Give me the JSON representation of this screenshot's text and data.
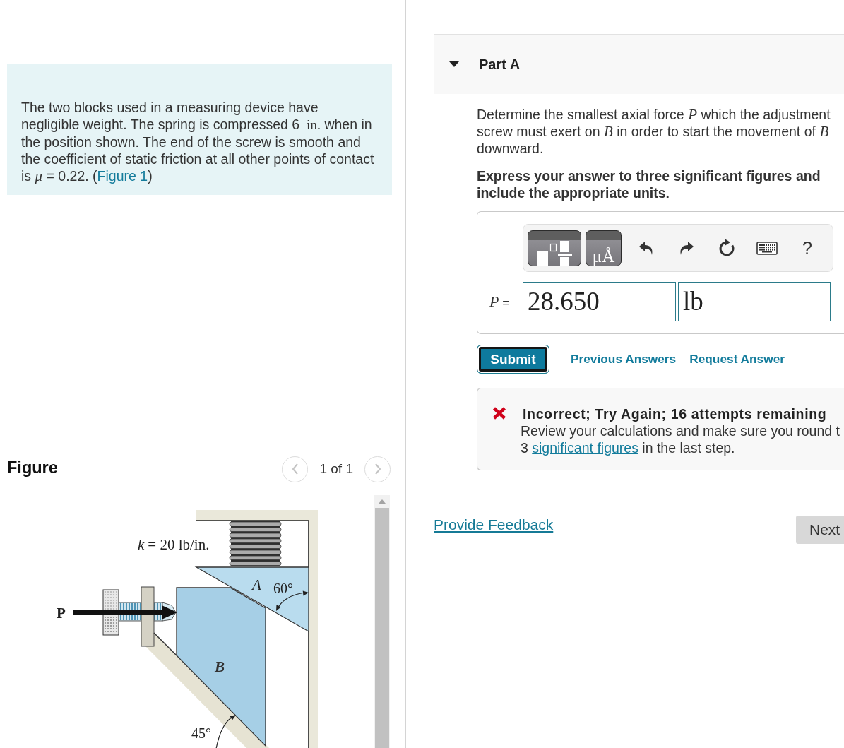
{
  "problem": {
    "segments": [
      {
        "kind": "text",
        "text": "The two blocks used in a measuring device have negligible weight. The spring is compressed 6"
      },
      {
        "kind": "unit",
        "text": "in."
      },
      {
        "kind": "text",
        "text": " when in the position shown. The end of the screw is smooth and the coefficient of static friction at all other points of contact is "
      },
      {
        "kind": "math",
        "text": "μ"
      },
      {
        "kind": "text",
        "text": " = 0.22. ("
      },
      {
        "kind": "link",
        "text": "Figure 1"
      },
      {
        "kind": "text",
        "text": ")"
      }
    ]
  },
  "figure": {
    "title": "Figure",
    "pager": {
      "previous": {
        "disabled": true
      },
      "text": "1 of 1",
      "next": {
        "disabled": true
      }
    },
    "labels": {
      "spring_constant": {
        "symbol": "k",
        "value": "= 20 lb/in."
      },
      "force": "P",
      "block_a": "A",
      "angle_a": "60°",
      "block_b": "B",
      "angle_b": "45°"
    }
  },
  "part": {
    "title": "Part A",
    "expanded": true,
    "question": [
      {
        "kind": "text",
        "text": "Determine the smallest axial force "
      },
      {
        "kind": "math",
        "text": "P"
      },
      {
        "kind": "text",
        "text": " which the adjustment screw must exert on "
      },
      {
        "kind": "math",
        "text": "B"
      },
      {
        "kind": "text",
        "text": " in order to start the movement of "
      },
      {
        "kind": "math",
        "text": "B"
      },
      {
        "kind": "text",
        "text": " downward."
      }
    ],
    "instruction": "Express your answer to three significant figures and include the appropriate units.",
    "toolbar": [
      {
        "kind": "templates"
      },
      {
        "kind": "units",
        "label": "μÅ"
      },
      {
        "kind": "undo"
      },
      {
        "kind": "redo"
      },
      {
        "kind": "reset"
      },
      {
        "kind": "keyboard"
      },
      {
        "kind": "help",
        "label": "?"
      }
    ],
    "answer": {
      "label": [
        {
          "kind": "math",
          "text": "P"
        },
        {
          "kind": "text",
          "text": " ="
        }
      ],
      "value": "28.650",
      "unit": "lb"
    },
    "submit": {
      "label": "Submit",
      "focused": true
    },
    "links": [
      "Previous Answers",
      "Request Answer"
    ],
    "feedback": {
      "correct": false,
      "title": "Incorrect; Try Again; 16 attempts remaining",
      "message": [
        {
          "kind": "text",
          "text": "Review your calculations and make sure you round t 3 "
        },
        {
          "kind": "link",
          "text": "significant figures"
        },
        {
          "kind": "text",
          "text": " in the last step."
        }
      ]
    }
  },
  "footer": {
    "feedback_link": "Provide Feedback",
    "next_button": "Next"
  }
}
